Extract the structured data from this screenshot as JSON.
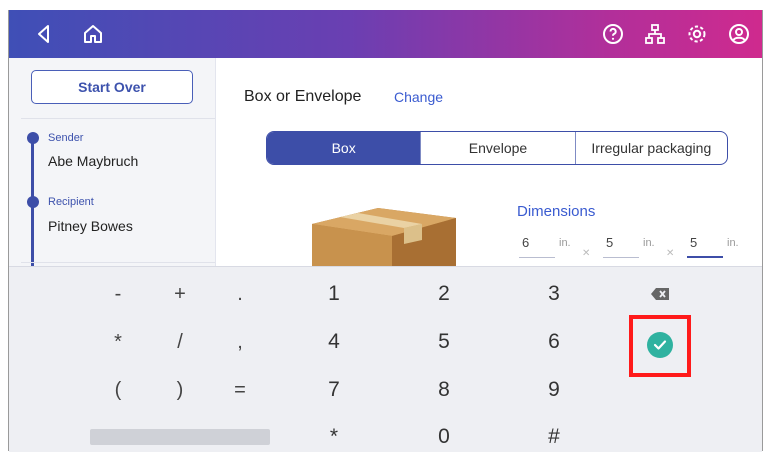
{
  "colors": {
    "brand": "#3d4ea8",
    "link": "#3a5bd0",
    "confirm": "#2fb2a0",
    "highlight": "#ff1a1a"
  },
  "topbar": {
    "icons": [
      "back-icon",
      "home-icon",
      "help-icon",
      "network-icon",
      "settings-icon",
      "account-icon"
    ]
  },
  "sidebar": {
    "start_over": "Start Over",
    "steps": [
      {
        "label": "Sender",
        "value": "Abe Maybruch"
      },
      {
        "label": "Recipient",
        "value": "Pitney Bowes"
      }
    ]
  },
  "main": {
    "title": "Box or Envelope",
    "change": "Change",
    "segments": [
      "Box",
      "Envelope",
      "Irregular packaging"
    ],
    "selected_segment": "Box",
    "dimensions": {
      "title": "Dimensions",
      "unit": "in.",
      "values": [
        "6",
        "5",
        "5"
      ]
    }
  },
  "keypad": {
    "rows": [
      [
        "-",
        "+",
        ".",
        "1",
        "2",
        "3"
      ],
      [
        "*",
        "/",
        ",",
        "4",
        "5",
        "6"
      ],
      [
        "(",
        ")",
        "=",
        "7",
        "8",
        "9"
      ],
      [
        "*",
        "0",
        "#"
      ]
    ]
  }
}
